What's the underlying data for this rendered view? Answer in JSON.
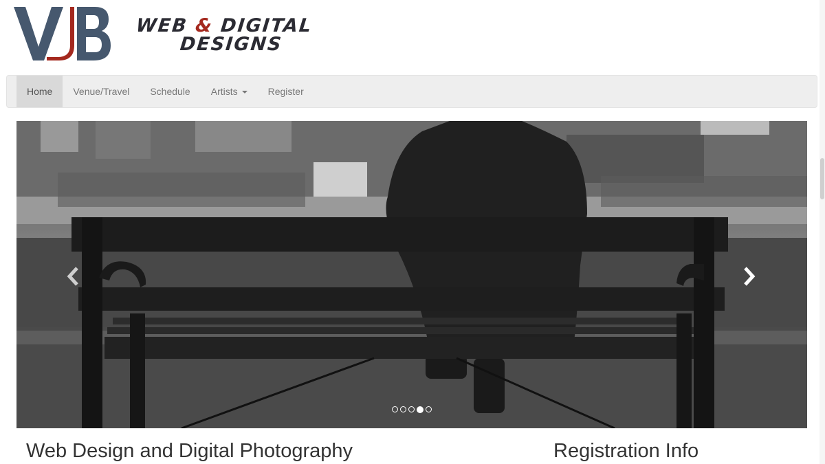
{
  "brand": {
    "monogram": "VJB",
    "line1_a": "WEB",
    "line1_amp": "&",
    "line1_b": "DIGITAL",
    "line2": "DESIGNS",
    "colors": {
      "blue": "#46586e",
      "red": "#a4281e",
      "dark": "#2b2b33"
    }
  },
  "nav": {
    "items": [
      {
        "label": "Home",
        "active": true
      },
      {
        "label": "Venue/Travel",
        "active": false
      },
      {
        "label": "Schedule",
        "active": false
      },
      {
        "label": "Artists",
        "active": false,
        "dropdown": true
      },
      {
        "label": "Register",
        "active": false
      }
    ]
  },
  "carousel": {
    "slide_count": 5,
    "active_index": 3,
    "prev_icon": "chevron-left-icon",
    "next_icon": "chevron-right-icon"
  },
  "sections": {
    "left_heading": "Web Design and Digital Photography",
    "right_heading": "Registration Info"
  }
}
